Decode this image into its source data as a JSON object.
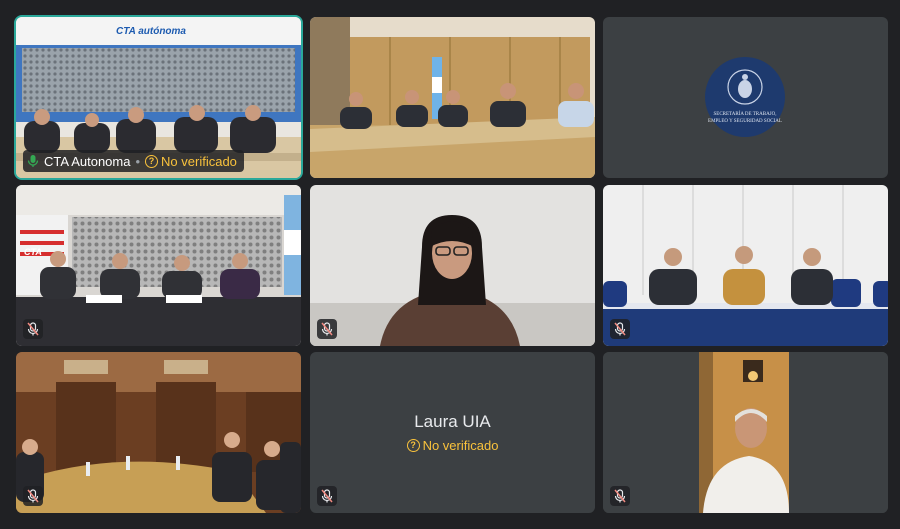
{
  "tiles": [
    {
      "name": "CTA Autonoma",
      "verification": "No verificado",
      "banner": "CTA autónoma",
      "active": true
    },
    {
      "name": "",
      "verification": ""
    },
    {
      "name": "",
      "verification": "",
      "seal_text_1": "SECRETARÍA DE TRABAJO,",
      "seal_text_2": "EMPLEO Y SEGURIDAD SOCIAL"
    },
    {
      "name": "",
      "verification": "",
      "banner": "CTA"
    },
    {
      "name": "",
      "verification": ""
    },
    {
      "name": "",
      "verification": ""
    },
    {
      "name": "",
      "verification": ""
    },
    {
      "name": "Laura UIA",
      "verification": "No verificado"
    },
    {
      "name": "",
      "verification": ""
    }
  ],
  "icons": {
    "mic_muted": "mic-off-icon",
    "verify": "question-circle-icon"
  },
  "colors": {
    "background": "#202124",
    "tile": "#3c4043",
    "active_border": "#2aa89a",
    "warning": "#f9c23c"
  }
}
